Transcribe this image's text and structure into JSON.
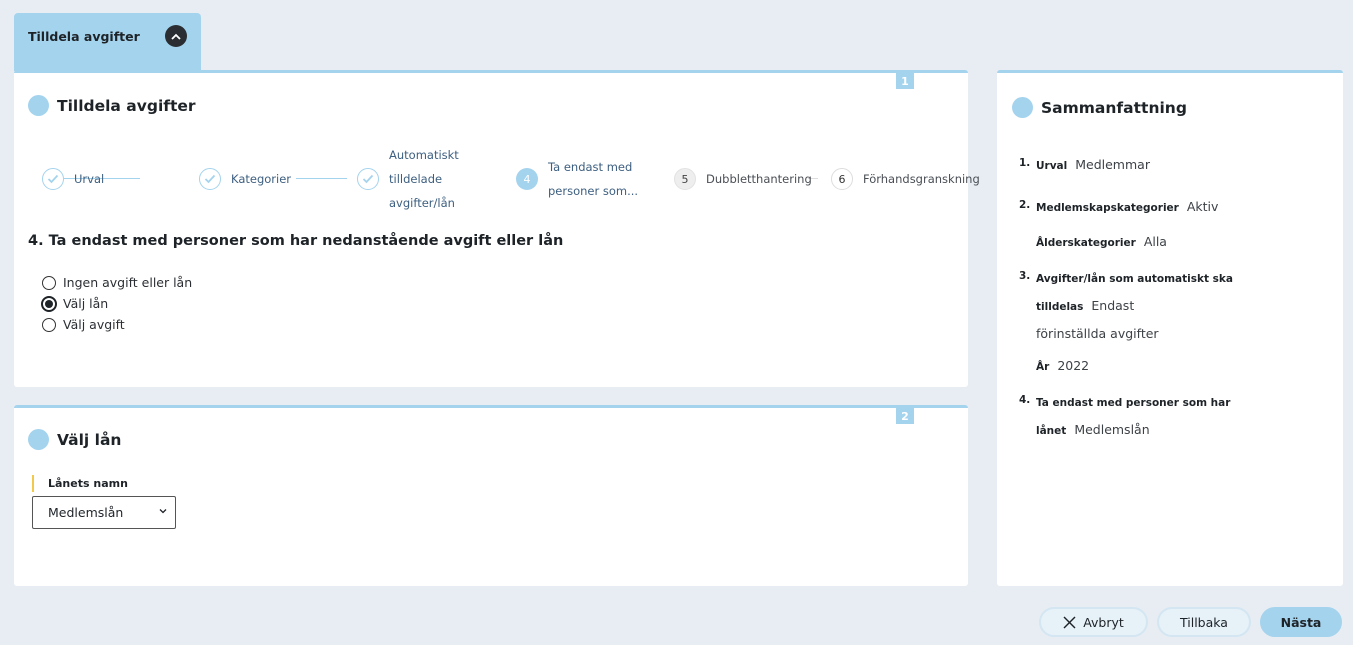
{
  "tab": {
    "title": "Tilldela avgifter"
  },
  "main": {
    "card_number": "1",
    "title": "Tilldela avgifter",
    "steps": [
      {
        "label": "Urval",
        "state": "done"
      },
      {
        "label": "Kategorier",
        "state": "done"
      },
      {
        "label_lines": [
          "Automatiskt",
          "tilldelade",
          "avgifter/lån"
        ],
        "state": "done"
      },
      {
        "number": "4",
        "label_lines": [
          "Ta endast med",
          "personer som..."
        ],
        "state": "active"
      },
      {
        "number": "5",
        "label": "Dubbletthantering",
        "state": "todo"
      },
      {
        "number": "6",
        "label": "Förhandsgranskning",
        "state": "todo"
      }
    ],
    "question": "4. Ta endast med personer som har nedanstående avgift eller lån",
    "options": [
      {
        "label": "Ingen avgift eller lån",
        "checked": false
      },
      {
        "label": "Välj lån",
        "checked": true
      },
      {
        "label": "Välj avgift",
        "checked": false
      }
    ]
  },
  "loan": {
    "card_number": "2",
    "title": "Välj lån",
    "field_label": "Lånets namn",
    "selected": "Medlemslån"
  },
  "summary": {
    "title": "Sammanfattning",
    "items": [
      {
        "num": "1.",
        "lines": [
          {
            "key": "Urval",
            "value": "Medlemmar"
          }
        ]
      },
      {
        "num": "2.",
        "lines": [
          {
            "key": "Medlemskapskategorier",
            "value": "Aktiv"
          },
          {
            "key": "Ålderskategorier",
            "value": "Alla"
          }
        ]
      },
      {
        "num": "3.",
        "lines": [
          {
            "key": "Avgifter/lån som automatiskt ska tilldelas",
            "value": "Endast"
          },
          {
            "key": "",
            "value": "förinställda avgifter"
          },
          {
            "key": "År",
            "value": "2022"
          }
        ]
      },
      {
        "num": "4.",
        "lines": [
          {
            "key": "Ta endast med personer som har lånet",
            "value": "Medlemslån"
          }
        ]
      }
    ]
  },
  "buttons": {
    "cancel": "Avbryt",
    "back": "Tillbaka",
    "next": "Nästa"
  },
  "colors": {
    "accent": "#a4d3ee",
    "background": "#e8edf3",
    "field_marker": "#f2c94c"
  }
}
